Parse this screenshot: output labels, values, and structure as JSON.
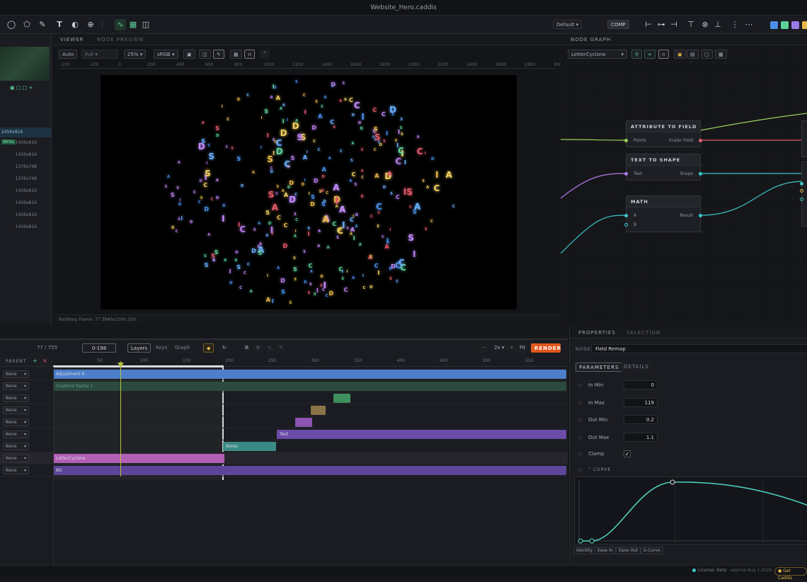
{
  "app": {
    "title": "Website_Hero.caddis"
  },
  "toolbar": {
    "preset": "Default",
    "comp": "COMP",
    "swatches": [
      "#4a8fe8",
      "#5fd29b",
      "#9a7be8",
      "#e8b84a"
    ]
  },
  "left": {
    "rows": [
      "2456x816",
      "1456x816",
      "1456x816",
      "1376x768",
      "1376x768",
      "1456x816",
      "1456x816",
      "1456x816",
      "1456x816"
    ],
    "tag": "Write"
  },
  "viewer": {
    "tab1": "VIEWER",
    "tab2": "NODE PREVIEW",
    "auto": "Auto",
    "full": "Full",
    "zoom": "25%",
    "color": "sRGB",
    "ruler": [
      "-100",
      "-200",
      "0",
      "200",
      "400",
      "600",
      "800",
      "1000",
      "1200",
      "1400",
      "1600",
      "1800",
      "2000",
      "2200",
      "2400",
      "2600",
      "2800",
      "3000"
    ],
    "status": "TextWarp    Frame: 77    3840x2160    25%"
  },
  "nodegraph": {
    "tab": "NODE GRAPH",
    "selector": "LetterCyclone",
    "nodes": [
      {
        "title": "ATTRIBUTE TO FIELD",
        "in": "Points",
        "out": "Scalar Field"
      },
      {
        "title": "TEXT TO SHAPE",
        "in": "Text",
        "out": "Shape"
      },
      {
        "title": "MATH",
        "in": "A",
        "in2": "B",
        "out": "Result"
      }
    ]
  },
  "timeline": {
    "frame": "77 / 755",
    "range": "0-198",
    "tab_layers": "Layers",
    "tab_keys": "Keys",
    "tab_graph": "Graph",
    "speed": "2x",
    "fit": "Fit",
    "render": "RENDER",
    "parent_header": "PARENT",
    "ticks": [
      "50",
      "100",
      "150",
      "200",
      "250",
      "300",
      "350",
      "400",
      "450",
      "500",
      "550"
    ],
    "parent_value": "None",
    "clips": {
      "adjustment": "Adjustment 9",
      "gradient": "Gradient Radial 1",
      "text": "Text",
      "noise": "Noise",
      "letter": "LetterCyclone",
      "bg": "BG"
    }
  },
  "properties": {
    "tab1": "PROPERTIES",
    "tab2": "SELECTION",
    "node_label": "NODE",
    "node_value": "Field Remap",
    "sub1": "PARAMETERS",
    "sub2": "DETAILS",
    "params": [
      {
        "label": "In Min",
        "value": "0"
      },
      {
        "label": "In Max",
        "value": "119"
      },
      {
        "label": "Out Min",
        "value": "0.2"
      },
      {
        "label": "Out Max",
        "value": "1.1"
      }
    ],
    "clamp": "Clamp",
    "curve": "CURVE",
    "presets": [
      "Identity",
      "Ease In",
      "Ease Out",
      "S-Curve"
    ]
  },
  "status": {
    "license": "License: Beta",
    "expires": "expires Aug 1 2026",
    "get": "Get Caddis"
  }
}
